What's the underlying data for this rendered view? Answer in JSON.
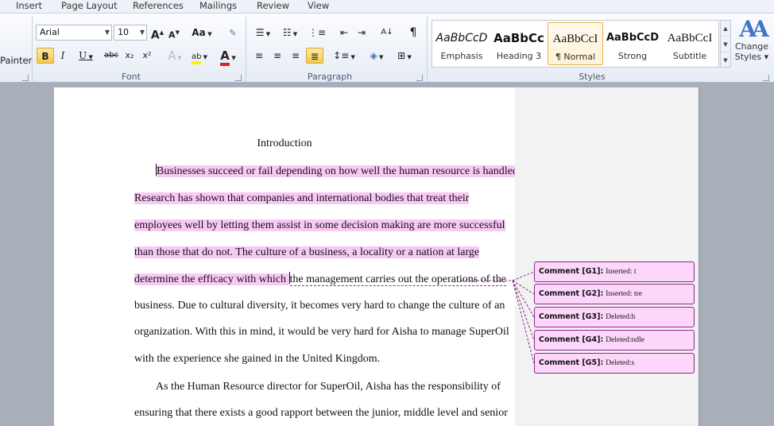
{
  "tabs": [
    "Insert",
    "Page Layout",
    "References",
    "Mailings",
    "Review",
    "View"
  ],
  "clipboard": {
    "painter_label": "Painter"
  },
  "font": {
    "name": "Arial",
    "size": "10",
    "group_label": "Font",
    "grow_label": "A",
    "shrink_label": "A",
    "case_label": "Aa",
    "bold": "B",
    "italic": "I",
    "strike": "abc",
    "subscript": "x₂",
    "superscript": "x²",
    "color_a": "A"
  },
  "paragraph": {
    "group_label": "Paragraph",
    "pilcrow": "¶"
  },
  "styles": {
    "group_label": "Styles",
    "items": [
      {
        "sample": "AaBbCcD",
        "name": "Emphasis"
      },
      {
        "sample": "AaBbCc",
        "name": "Heading 3"
      },
      {
        "sample": "AaBbCcI",
        "name": "¶ Normal"
      },
      {
        "sample": "AaBbCcD",
        "name": "Strong"
      },
      {
        "sample": "AaBbCcI",
        "name": "Subtitle"
      }
    ],
    "selected_index": 2,
    "change_label_1": "Change",
    "change_label_2": "Styles ▾"
  },
  "document": {
    "heading": "Introduction",
    "lines": [
      "Businesses succeed or fail depending on how well the human resource is handled.",
      "Research has shown that companies and international bodies that treat their",
      "employees well by letting them assist in some decision making are more successful",
      "than those that do not. The culture of a business, a locality or a nation at large",
      "determine the efficacy with which ",
      "the management carries out the operations of the",
      "business. Due to cultural diversity, it becomes very hard to change the culture of an",
      "organization. With this in mind, it would be very hard for Aisha to manage SuperOil",
      "with the experience she gained in the United Kingdom.",
      "As the Human Resource director for SuperOil, Aisha has the responsibility of",
      "ensuring that there exists a good rapport between the junior, middle level and senior"
    ]
  },
  "comments": [
    {
      "label": "Comment [G1]:",
      "text": "Inserted: t"
    },
    {
      "label": "Comment [G2]:",
      "text": "Inserted: tre"
    },
    {
      "label": "Comment [G3]:",
      "text": "Deleted:h"
    },
    {
      "label": "Comment [G4]:",
      "text": "Deleted:ndle"
    },
    {
      "label": "Comment [G5]:",
      "text": "Deleted:s"
    }
  ],
  "colors": {
    "highlight": "#f9c9f5",
    "comment_fill": "#fdd6fb",
    "comment_border": "#8c2a86",
    "selected_style": "#f7c94b"
  }
}
